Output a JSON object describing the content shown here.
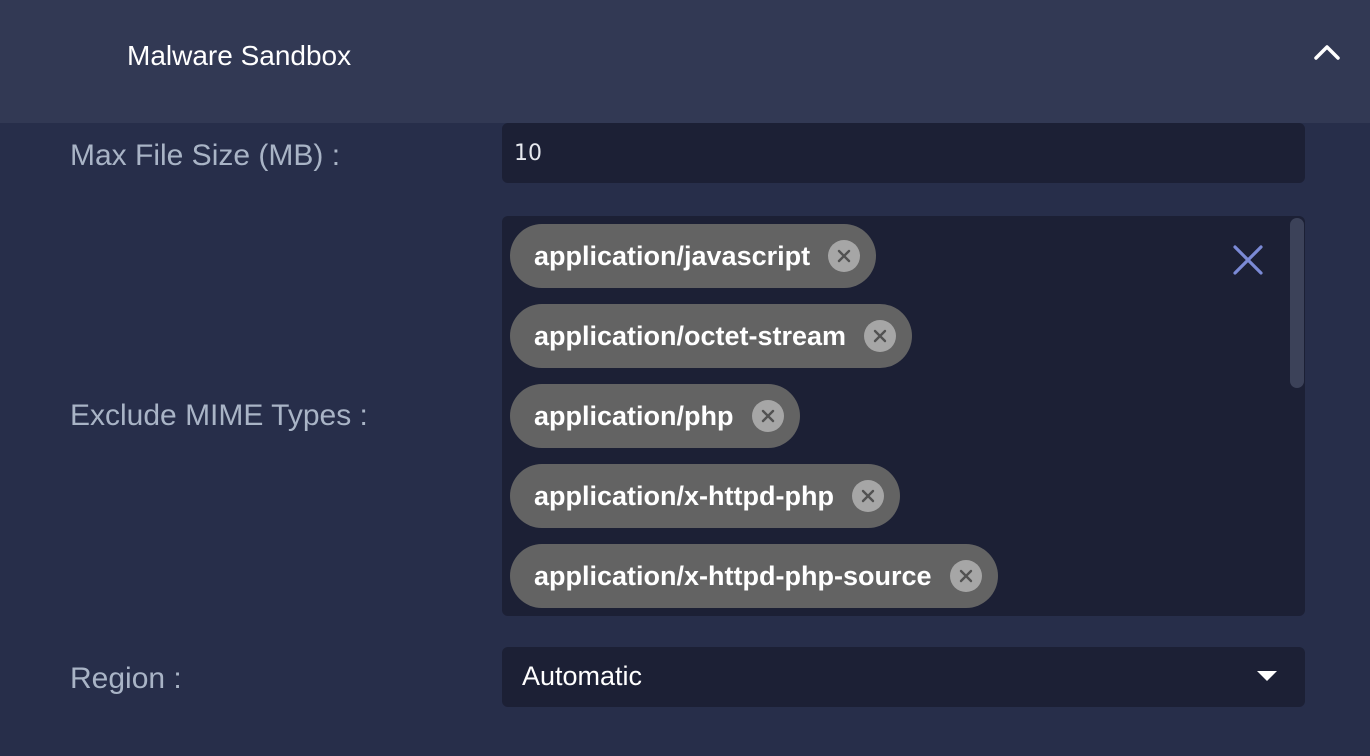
{
  "header": {
    "title": "Malware Sandbox",
    "collapse_icon": "chevron-up-icon"
  },
  "form": {
    "max_file_size": {
      "label": "Max File Size (MB) :",
      "value": "10"
    },
    "exclude_mime": {
      "label": "Exclude MIME Types :",
      "tags": [
        "application/javascript",
        "application/octet-stream",
        "application/php",
        "application/x-httpd-php",
        "application/x-httpd-php-source"
      ],
      "clear_icon": "close-icon",
      "remove_icon": "remove-chip-icon"
    },
    "region": {
      "label": "Region :",
      "selected": "Automatic",
      "arrow_icon": "caret-down-icon"
    }
  },
  "colors": {
    "background": "#272e4a",
    "header": "#323954",
    "field": "#1c2035",
    "chip": "#636363",
    "accent": "#7b8ad6"
  }
}
